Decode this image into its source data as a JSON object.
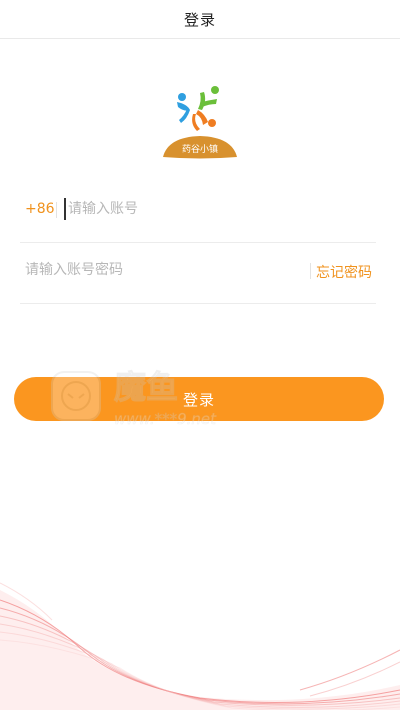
{
  "header": {
    "title": "登录"
  },
  "logo": {
    "brand_text": "药谷小镇",
    "icon": "pinwheel-people-logo"
  },
  "form": {
    "country_code": "+86",
    "phone_placeholder": "请输入账号",
    "phone_value": "",
    "password_placeholder": "请输入账号密码",
    "password_value": "",
    "forgot_label": "忘记密码"
  },
  "actions": {
    "login_label": "登录"
  },
  "watermark": {
    "text": "魔鱼",
    "url": "www.***9.net"
  },
  "colors": {
    "accent": "#f0921d",
    "button": "#fb961f",
    "logo_blue": "#2f9fe0",
    "logo_green": "#6bbf3a",
    "logo_orange": "#ef7d22",
    "logo_base": "#d8912e",
    "wave": "#ee6a6a"
  }
}
